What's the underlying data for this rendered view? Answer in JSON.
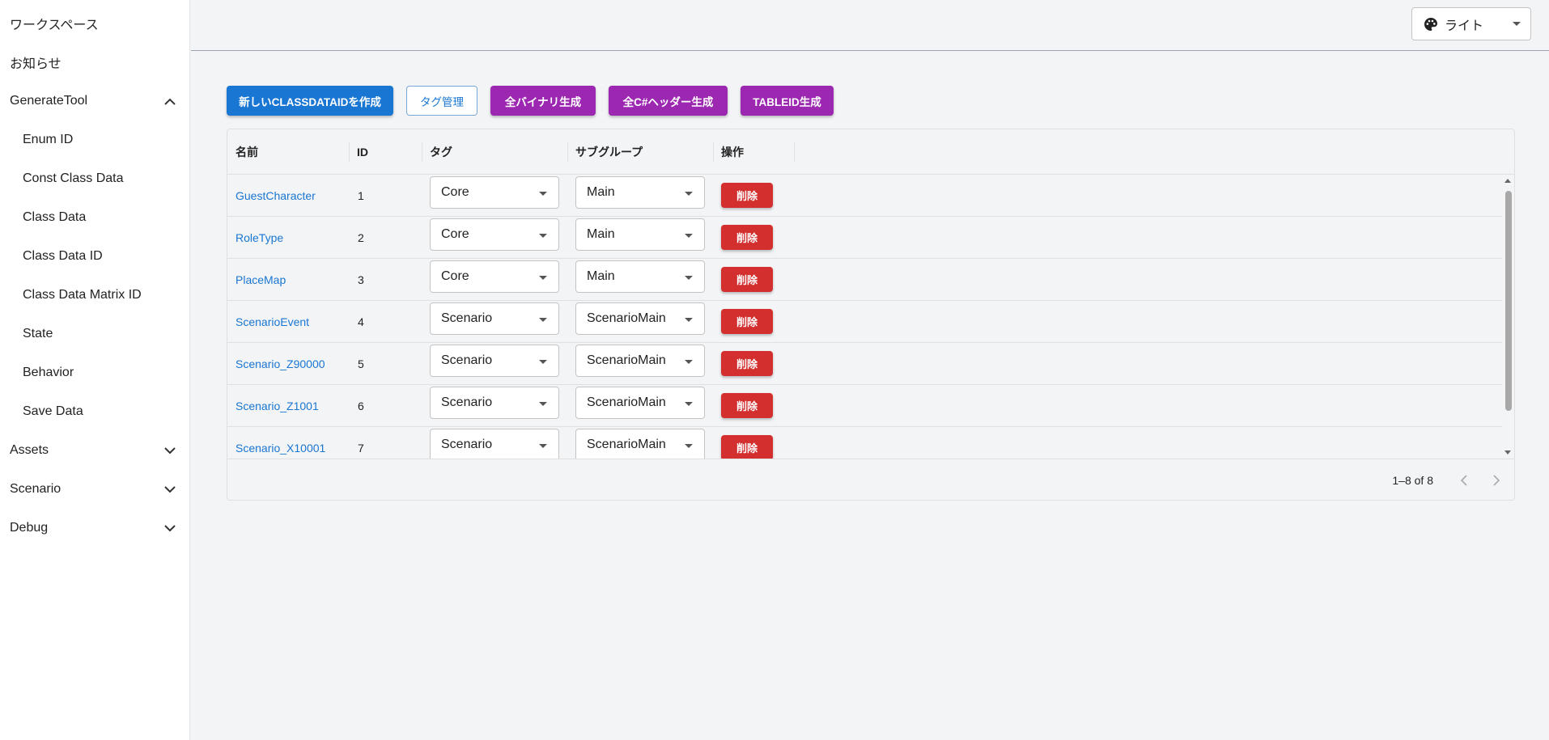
{
  "sidebar": {
    "items": [
      {
        "label": "ワークスペース"
      },
      {
        "label": "お知らせ"
      },
      {
        "label": "GenerateTool",
        "expanded": true
      },
      {
        "label": "Enum ID"
      },
      {
        "label": "Const Class Data"
      },
      {
        "label": "Class Data"
      },
      {
        "label": "Class Data ID"
      },
      {
        "label": "Class Data Matrix ID"
      },
      {
        "label": "State"
      },
      {
        "label": "Behavior"
      },
      {
        "label": "Save Data"
      },
      {
        "label": "Assets",
        "expanded": false
      },
      {
        "label": "Scenario",
        "expanded": false
      },
      {
        "label": "Debug",
        "expanded": false
      }
    ]
  },
  "theme": {
    "label": "ライト",
    "icon": "palette-icon"
  },
  "toolbar": {
    "create_label": "新しいCLASSDATAIDを作成",
    "tags_label": "タグ管理",
    "all_binary_label": "全バイナリ生成",
    "all_csharp_label": "全C#ヘッダー生成",
    "tableid_label": "TABLEID生成"
  },
  "table": {
    "columns": {
      "name": "名前",
      "id": "ID",
      "tag": "タグ",
      "subgroup": "サブグループ",
      "actions": "操作"
    },
    "delete_label": "削除",
    "rows": [
      {
        "name": "GuestCharacter",
        "id": "1",
        "tag": "Core",
        "subgroup": "Main"
      },
      {
        "name": "RoleType",
        "id": "2",
        "tag": "Core",
        "subgroup": "Main"
      },
      {
        "name": "PlaceMap",
        "id": "3",
        "tag": "Core",
        "subgroup": "Main"
      },
      {
        "name": "ScenarioEvent",
        "id": "4",
        "tag": "Scenario",
        "subgroup": "ScenarioMain"
      },
      {
        "name": "Scenario_Z90000",
        "id": "5",
        "tag": "Scenario",
        "subgroup": "ScenarioMain"
      },
      {
        "name": "Scenario_Z1001",
        "id": "6",
        "tag": "Scenario",
        "subgroup": "ScenarioMain"
      },
      {
        "name": "Scenario_X10001",
        "id": "7",
        "tag": "Scenario",
        "subgroup": "ScenarioMain"
      }
    ],
    "pagination": "1–8 of 8"
  },
  "colors": {
    "primary": "#1976d2",
    "secondary": "#9c27b0",
    "danger": "#d32f2f"
  }
}
